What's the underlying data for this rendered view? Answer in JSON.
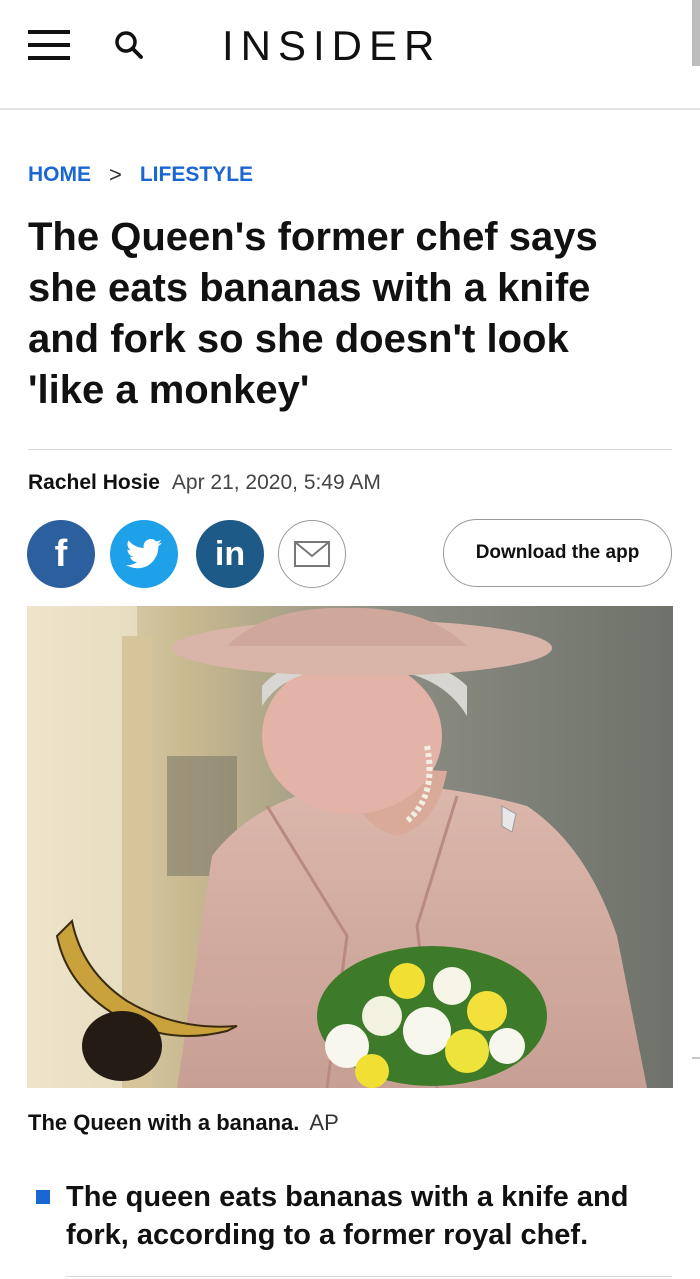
{
  "header": {
    "logo": "INSIDER",
    "menu_icon": "hamburger-menu-icon",
    "search_icon": "search-icon"
  },
  "breadcrumb": {
    "home": "HOME",
    "section": "LIFESTYLE",
    "separator_icon": "chevron-right-icon"
  },
  "article": {
    "headline": "The Queen's former chef says she eats bananas with a knife and fork so she doesn't look 'like a monkey'",
    "author": "Rachel Hosie",
    "date": "Apr 21, 2020, 5:49 AM"
  },
  "share": {
    "facebook_glyph": "f",
    "linkedin_glyph": "in",
    "icons": [
      "facebook-icon",
      "twitter-icon",
      "linkedin-icon",
      "email-icon"
    ],
    "download_label": "Download the app"
  },
  "image": {
    "caption": "The Queen with a banana.",
    "credit": "AP"
  },
  "key_points": [
    "The queen eats bananas with a knife and fork, according to a former royal chef."
  ],
  "colors": {
    "link_blue": "#1a66d2",
    "facebook": "#2c5f9e",
    "twitter": "#1ea1e9",
    "linkedin": "#1d5a87"
  }
}
